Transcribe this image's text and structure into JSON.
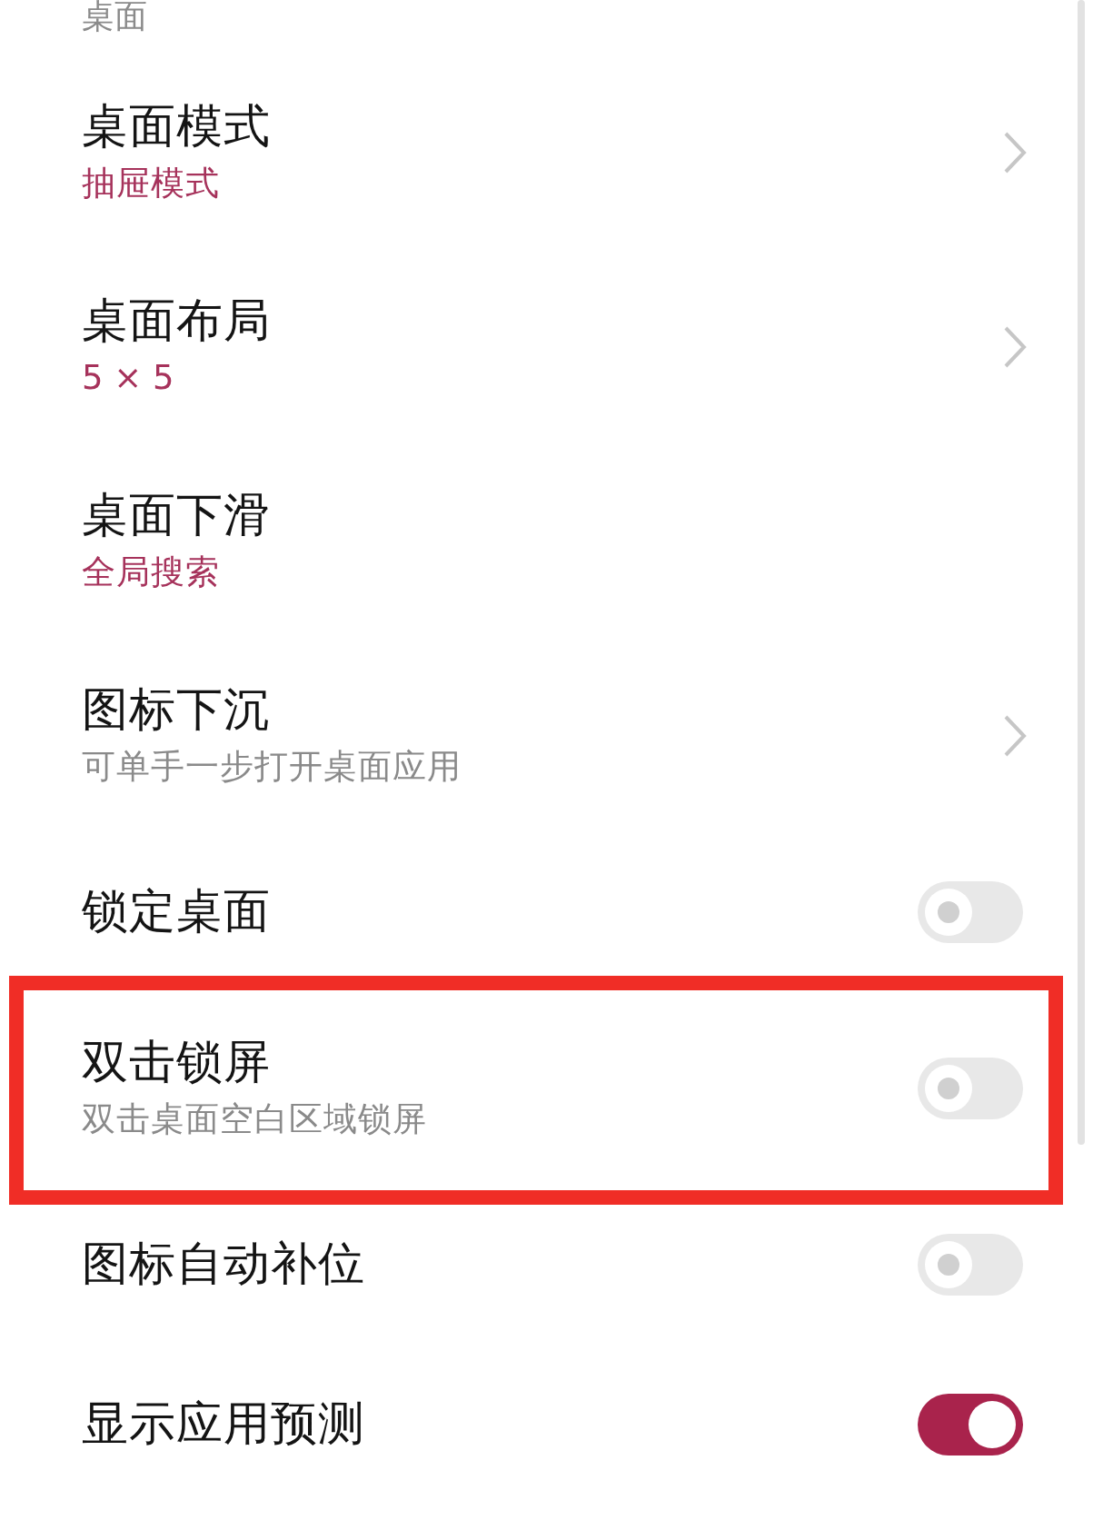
{
  "section": {
    "title": "桌面"
  },
  "items": [
    {
      "kind": "link",
      "title": "桌面模式",
      "value": "抽屉模式",
      "highlighted": false
    },
    {
      "kind": "link",
      "title": "桌面布局",
      "value": "5 × 5",
      "highlighted": false
    },
    {
      "kind": "plain",
      "title": "桌面下滑",
      "value": "全局搜索",
      "highlighted": false
    },
    {
      "kind": "link",
      "title": "图标下沉",
      "description": "可单手一步打开桌面应用",
      "highlighted": false
    },
    {
      "kind": "switch",
      "title": "锁定桌面",
      "on": false,
      "highlighted": false
    },
    {
      "kind": "switch",
      "title": "双击锁屏",
      "description": "双击桌面空白区域锁屏",
      "on": false,
      "highlighted": true
    },
    {
      "kind": "switch",
      "title": "图标自动补位",
      "on": false,
      "highlighted": false
    },
    {
      "kind": "switch",
      "title": "显示应用预测",
      "on": true,
      "highlighted": false
    }
  ]
}
